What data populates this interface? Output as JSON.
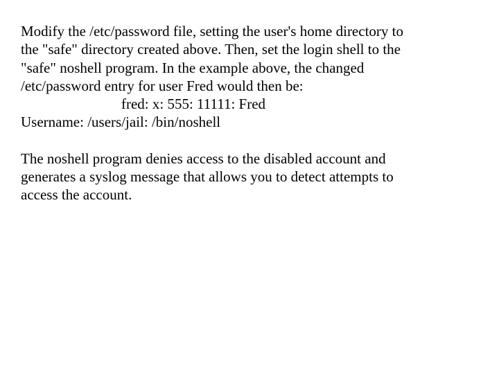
{
  "paragraph1": {
    "line1": "Modify the /etc/password file, setting the user's home directory to",
    "line2": "the \"safe\" directory created above. Then, set the login shell to the",
    "line3": "\"safe\" noshell program. In the example above, the changed",
    "line4": "/etc/password entry for user Fred would then be:",
    "line5_indented": "fred: x: 555: 11111: Fred",
    "line6": "Username: /users/jail: /bin/noshell"
  },
  "paragraph2": {
    "line1": "The noshell program denies access to the disabled account and",
    "line2": "generates a syslog message that allows you to detect attempts to",
    "line3": "access the account."
  }
}
